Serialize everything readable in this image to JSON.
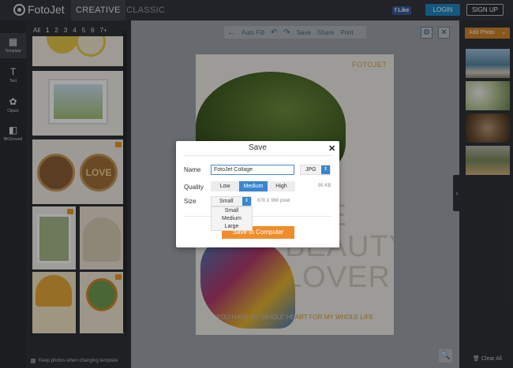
{
  "app": {
    "brand": "FotoJet"
  },
  "topbar": {
    "tabs": [
      {
        "label": "CREATIVE",
        "active": true
      },
      {
        "label": "CLASSIC",
        "active": false
      }
    ],
    "fb_like": "Like",
    "login": "LOGIN",
    "signup": "SIGN UP"
  },
  "rail": {
    "items": [
      {
        "label": "Template",
        "icon": "template-icon",
        "active": true
      },
      {
        "label": "Text",
        "icon": "text-icon",
        "active": false
      },
      {
        "label": "Clipart",
        "icon": "clipart-icon",
        "active": false
      },
      {
        "label": "BKGround",
        "icon": "background-icon",
        "active": false
      }
    ]
  },
  "templates": {
    "filters": [
      "All",
      "1",
      "2",
      "3",
      "4",
      "5",
      "6",
      "7+"
    ],
    "active_filter": "1",
    "keep_photos_label": "Keep photos when changing template"
  },
  "toolbar": {
    "autofill": "Auto Fill",
    "save": "Save",
    "share": "Share",
    "print": "Print"
  },
  "collage": {
    "brand": "FOTOJET",
    "big_text": "THE\nBEAUTY\nLOVER",
    "tagline_left": "YOU HAVE MY WHOLE HE",
    "tagline_right": "ART FOR MY WHOLE LIFE"
  },
  "right_panel": {
    "add_photo": "Add Photo",
    "clear_all": "Clear All"
  },
  "save_dialog": {
    "title": "Save",
    "name_label": "Name",
    "name_value": "FotoJet Collage",
    "format_value": "JPG",
    "quality_label": "Quality",
    "quality_options": [
      "Low",
      "Medium",
      "High"
    ],
    "quality_selected": "Medium",
    "quality_size": "95 KB",
    "size_label": "Size",
    "size_value": "Small",
    "size_pixels": "678 X 960 pixel",
    "size_options": [
      "Small",
      "Medium",
      "Large"
    ],
    "save_button": "Save to Computer"
  },
  "colors": {
    "accent_blue": "#3a86cf",
    "accent_orange": "#ef8d2a",
    "topbar_bg": "#33373e"
  }
}
